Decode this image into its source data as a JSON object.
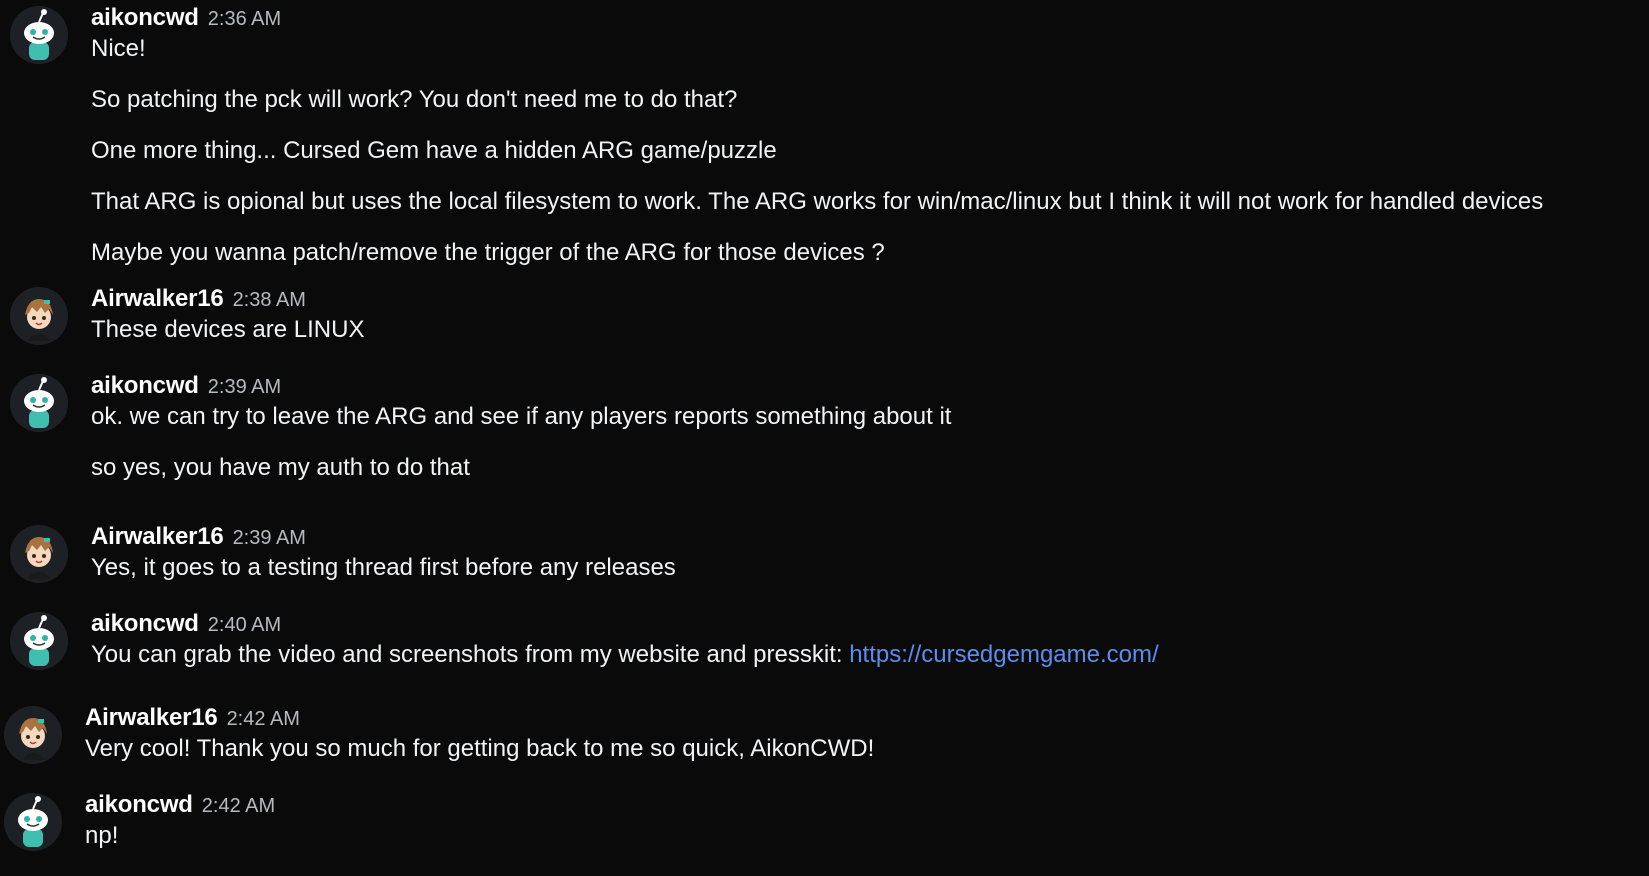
{
  "messages": [
    {
      "author": "aikoncwd",
      "time": "2:36 AM",
      "avatar": "snoo-teal-icon",
      "lines": [
        "Nice!",
        "So patching the pck will work? You don't need me to do that?",
        "One more thing... Cursed Gem have a hidden ARG game/puzzle",
        "That ARG is opional but uses the local filesystem to work. The ARG works for win/mac/linux but I think it will not work for handled devices",
        "Maybe you wanna patch/remove the trigger of the ARG for those devices ?"
      ]
    },
    {
      "author": "Airwalker16",
      "time": "2:38 AM",
      "avatar": "anime-boy-icon",
      "lines": [
        "These devices are LINUX"
      ]
    },
    {
      "author": "aikoncwd",
      "time": "2:39 AM",
      "avatar": "snoo-teal-icon",
      "lines": [
        "ok. we can try to leave the ARG and see if any players reports something about it",
        "so yes, you have my auth to do that"
      ]
    },
    {
      "author": "Airwalker16",
      "time": "2:39 AM",
      "avatar": "anime-boy-icon",
      "lines": [
        "Yes, it goes to a testing thread first before any releases"
      ]
    },
    {
      "author": "aikoncwd",
      "time": "2:40 AM",
      "avatar": "snoo-teal-icon",
      "lines": [
        "You can grab the video and screenshots from my website and presskit: "
      ],
      "link": "https://cursedgemgame.com/"
    },
    {
      "author": "Airwalker16",
      "time": "2:42 AM",
      "avatar": "anime-boy-icon",
      "lines": [
        "Very cool! Thank you so much for getting back to me so quick, AikonCWD!"
      ]
    },
    {
      "author": "aikoncwd",
      "time": "2:42 AM",
      "avatar": "snoo-teal-icon",
      "lines": [
        "np!"
      ]
    }
  ],
  "colors": {
    "background": "#0a0a0a",
    "text": "#f2f3f5",
    "timestamp": "#b5bac1",
    "link": "#5b8def"
  }
}
